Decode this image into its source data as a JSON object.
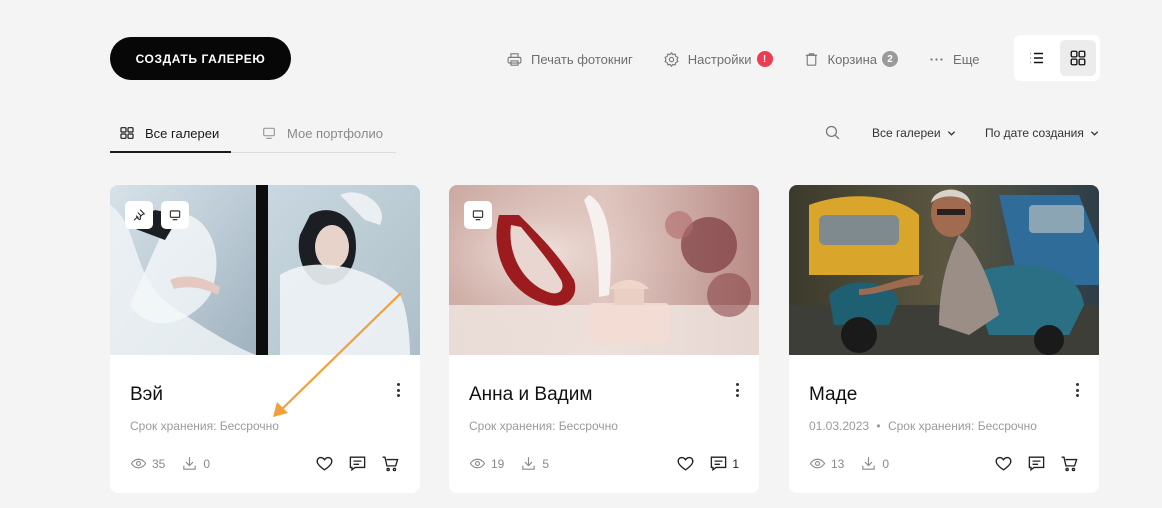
{
  "toolbar": {
    "create_label": "СОЗДАТЬ ГАЛЕРЕЮ",
    "print_label": "Печать фотокниг",
    "settings_label": "Настройки",
    "settings_badge": "!",
    "trash_label": "Корзина",
    "trash_badge": "2",
    "more_label": "Еще"
  },
  "view_toggle": {
    "active": "grid"
  },
  "tabs": [
    {
      "label": "Все галереи",
      "active": true
    },
    {
      "label": "Мое портфолио",
      "active": false
    }
  ],
  "filters": {
    "galleries": "Все галереи",
    "sort": "По дате создания"
  },
  "cards": [
    {
      "title": "Вэй",
      "date": "",
      "storage": "Срок хранения: Бессрочно",
      "views": "35",
      "downloads": "0",
      "comments": "",
      "pinned": true
    },
    {
      "title": "Анна и Вадим",
      "date": "",
      "storage": "Срок хранения: Бессрочно",
      "views": "19",
      "downloads": "5",
      "comments": "1",
      "pinned": false
    },
    {
      "title": "Маде",
      "date": "01.03.2023",
      "separator": "•",
      "storage": "Срок хранения: Бессрочно",
      "views": "13",
      "downloads": "0",
      "comments": "",
      "pinned": false
    }
  ],
  "colors": {
    "accent": "#070707",
    "badge_red": "#ea3c53",
    "annotation_arrow": "#f2a03d"
  }
}
